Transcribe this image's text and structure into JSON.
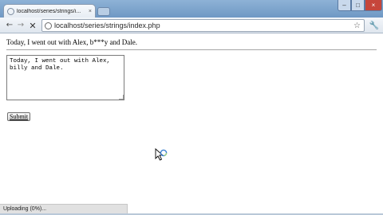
{
  "browser": {
    "tab_title": "localhost/series/strings/i...",
    "tab_close": "×",
    "url": "localhost/series/strings/index.php",
    "icons": {
      "back": "back-arrow-icon",
      "forward": "forward-arrow-icon",
      "stop": "stop-icon",
      "bookmark": "star-icon",
      "settings": "wrench-icon"
    },
    "window_buttons": {
      "minimize": "–",
      "maximize": "□",
      "close": "×"
    },
    "status": "Uploading (0%)..."
  },
  "page": {
    "output": "Today, I went out with Alex, b***y and Dale.",
    "textarea_value": "Today, I went out with Alex,\nbilly and Dale.",
    "submit_label": "Submit"
  },
  "colors": {
    "titlebar": "#7fa6cf",
    "close_button": "#c6463b"
  }
}
